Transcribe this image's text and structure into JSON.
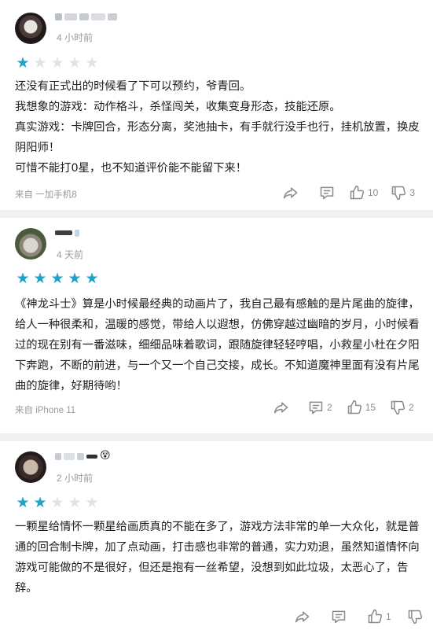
{
  "comments": [
    {
      "time": "4 小时前",
      "rating": 1,
      "body": "还没有正式出的时候看了下可以预约，爷青回。\n我想象的游戏：动作格斗，杀怪闯关，收集变身形态，技能还原。\n真实游戏：卡牌回合，形态分离，奖池抽卡，有手就行没手也行，挂机放置，换皮阴阳师！\n可惜不能打0星，也不知道评价能不能留下来！",
      "device": "来自 一加手机8",
      "reply_count": "",
      "like_count": "10",
      "dislike_count": "3"
    },
    {
      "time": "4 天前",
      "rating": 5,
      "body": "《神龙斗士》算是小时候最经典的动画片了，我自己最有感触的是片尾曲的旋律，给人一种很柔和，温暖的感觉，带给人以遐想，仿佛穿越过幽暗的岁月，小时候看过的现在别有一番滋味，细细品味着歌词，跟随旋律轻轻哼唱，小救星小杜在夕阳下奔跑，不断的前进，与一个又一个自己交接，成长。不知道魔神里面有没有片尾曲的旋律，好期待哟！",
      "device": "来自 iPhone 11",
      "reply_count": "2",
      "like_count": "15",
      "dislike_count": "2"
    },
    {
      "time": "2 小时前",
      "rating": 2,
      "body": "一颗星给情怀一颗星给画质真的不能在多了，游戏方法非常的单一大众化，就是普通的回合制卡牌，加了点动画，打击感也非常的普通，实力劝退，虽然知道情怀向游戏可能做的不是很好，但还是抱有一丝希望，没想到如此垃圾，太恶心了，告辞。",
      "device": "",
      "reply_count": "",
      "like_count": "1",
      "dislike_count": ""
    }
  ],
  "colors": {
    "star_on": "#1fa3c9",
    "star_off": "#dfe2e6",
    "background": "#eef0f2"
  },
  "icons": {
    "share": "share-icon",
    "reply": "comment-icon",
    "like": "thumbs-up-icon",
    "dislike": "thumbs-down-icon"
  }
}
